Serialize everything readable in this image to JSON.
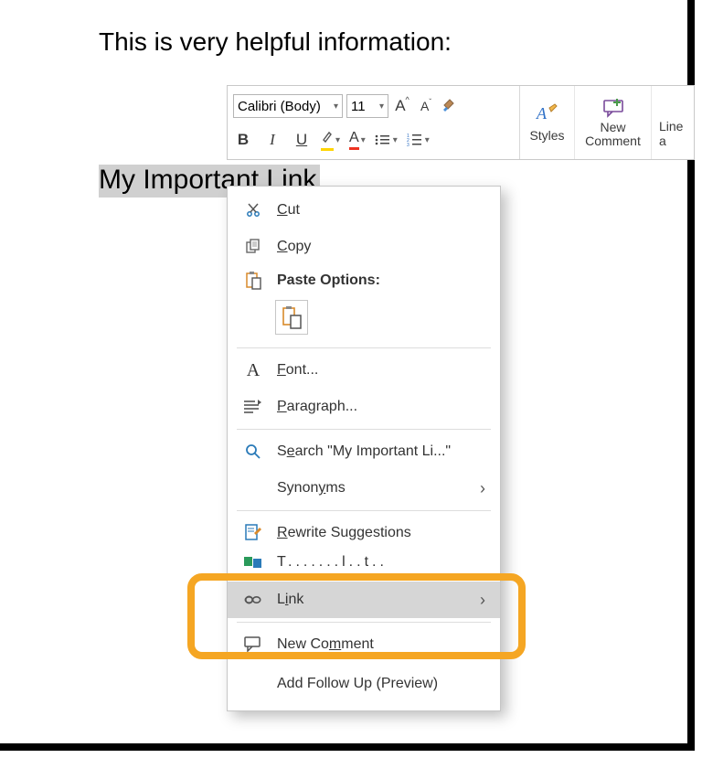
{
  "doc": {
    "heading": "This is very helpful information:",
    "selected_text": "My Important Link"
  },
  "toolbar": {
    "font_name": "Calibri (Body)",
    "font_size": "11",
    "styles_label": "Styles",
    "new_comment_label": "New Comment",
    "line_label": "Line a"
  },
  "context_menu": {
    "cut": "Cut",
    "copy": "Copy",
    "paste_options": "Paste Options:",
    "font": "Font...",
    "paragraph": "Paragraph...",
    "search": "Search \"My Important Li...\"",
    "synonyms": "Synonyms",
    "rewrite": "Rewrite Suggestions",
    "translate": "Translate",
    "link": "Link",
    "new_comment": "New Comment",
    "follow_up": "Add Follow Up (Preview)"
  }
}
